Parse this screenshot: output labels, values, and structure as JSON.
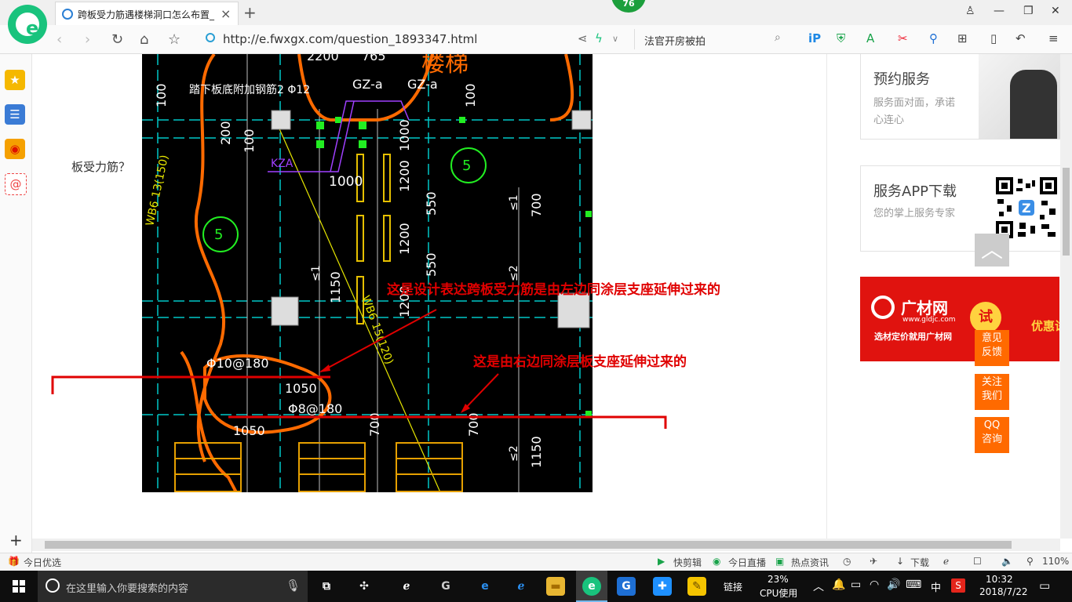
{
  "browser": {
    "badge": "76",
    "tab_title": "跨板受力筋遇楼梯洞口怎么布置_",
    "url": "http://e.fwxgx.com/question_1893347.html",
    "search_text": "法官开房被拍"
  },
  "page": {
    "question_fragment": "板受力筋？",
    "cad": {
      "top_labels": [
        "2200",
        "765"
      ],
      "stair_label": "楼梯",
      "rebar_note": "踏下板底附加钢筋2 Φ12",
      "gz_labels": [
        "GZ-a",
        "GZ-a"
      ],
      "kza_label": "KZA",
      "dims": [
        "100",
        "100",
        "200",
        "100",
        "1000",
        "1000",
        "1200",
        "550",
        "1200",
        "550",
        "1200",
        "1150",
        "700",
        "700",
        "700",
        "1150",
        "1050",
        "1050",
        "≤1",
        "≤2",
        "≤1",
        "≤2"
      ],
      "axis_marks": [
        "5",
        "5"
      ],
      "diag_labels": [
        "WB6 13(150)",
        "WB6 15(120)"
      ],
      "bar_spec_1": "Φ10@180",
      "bar_spec_2": "Φ8@180",
      "annotation_left": "这是设计表达跨板受力筋是由左边同涂层支座延伸过来的",
      "annotation_right": "这是由右边同涂层板支座延伸过来的"
    },
    "sidebar_cards": [
      {
        "title": "预约服务",
        "subtitle": "服务面对面，承诺心连心"
      },
      {
        "title": "服务APP下载",
        "subtitle": "您的掌上服务专家"
      }
    ],
    "ad": {
      "brand": "广材网",
      "domain": "www.gldjc.com",
      "slogan": "选材定价就用广材网",
      "badge": "试",
      "tail": "优惠试用"
    },
    "float_buttons": [
      "意见反馈",
      "关注我们",
      "QQ咨询"
    ]
  },
  "statusbar": {
    "left": "今日优选",
    "items": [
      "快剪辑",
      "今日直播",
      "热点资讯",
      "下载"
    ],
    "zoom": "110%"
  },
  "taskbar": {
    "search_placeholder": "在这里输入你要搜索的内容",
    "links_label": "链接",
    "cpu_percent": "23%",
    "cpu_label": "CPU使用",
    "ime": "中",
    "time": "10:32",
    "date": "2018/7/22"
  },
  "colors": {
    "brand_green": "#19c37d",
    "accent_orange": "#ff6a00",
    "ad_red": "#e0130f",
    "annotation_red": "#e00000"
  }
}
